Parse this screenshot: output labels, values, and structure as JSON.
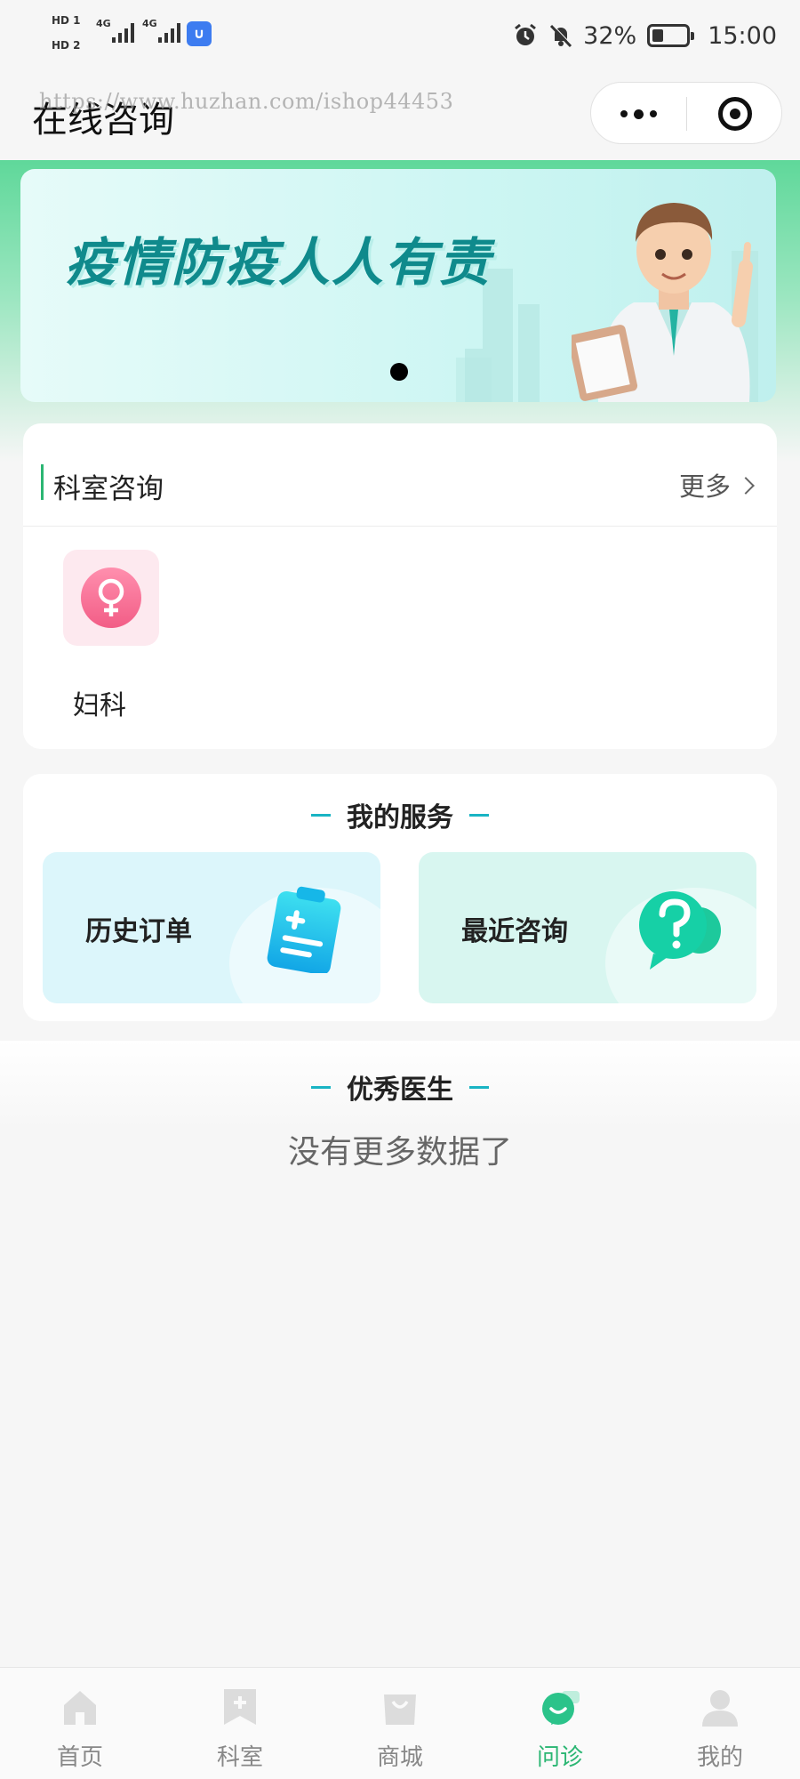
{
  "status_bar": {
    "hd1": "HD 1",
    "hd2": "HD 2",
    "net1": "4G",
    "net2": "4G",
    "battery_percent": "32%",
    "time": "15:00",
    "battery_level": 0.32
  },
  "nav": {
    "title": "在线咨询",
    "watermark": "https://www.huzhan.com/ishop44453"
  },
  "banner": {
    "text": "疫情防疫人人有责",
    "slide_count": 1,
    "active_slide": 1
  },
  "department": {
    "title": "科室咨询",
    "more_label": "更多",
    "items": [
      {
        "label": "妇科",
        "icon": "female-symbol-icon"
      }
    ]
  },
  "services": {
    "title": "我的服务",
    "items": [
      {
        "label": "历史订单",
        "icon": "clipboard-icon"
      },
      {
        "label": "最近咨询",
        "icon": "question-chat-icon"
      }
    ]
  },
  "doctors": {
    "title": "优秀医生",
    "empty_text": "没有更多数据了"
  },
  "tab_bar": {
    "items": [
      {
        "label": "首页",
        "icon": "home-icon"
      },
      {
        "label": "科室",
        "icon": "clinic-icon"
      },
      {
        "label": "商城",
        "icon": "shop-bag-icon"
      },
      {
        "label": "问诊",
        "icon": "consult-chat-icon"
      },
      {
        "label": "我的",
        "icon": "user-icon"
      }
    ],
    "active": "问诊"
  },
  "colors": {
    "accent_green": "#2bb673",
    "section_dash": "#19b4c4",
    "banner_text": "#0f8a8c"
  }
}
